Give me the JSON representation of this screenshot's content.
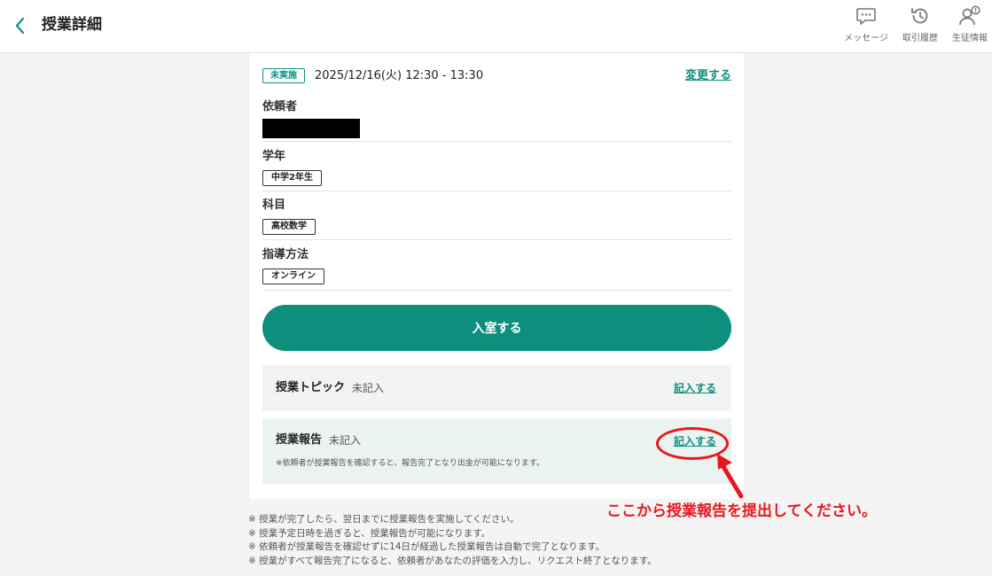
{
  "header": {
    "title": "授業詳細",
    "nav": [
      {
        "label": "メッセージ",
        "icon": "chat-bubble-icon"
      },
      {
        "label": "取引履歴",
        "icon": "history-clock-icon"
      },
      {
        "label": "生徒情報",
        "icon": "student-info-icon"
      }
    ]
  },
  "lesson": {
    "status": "未実施",
    "datetime": "2025/12/16(火) 12:30 - 13:30",
    "change_label": "変更する",
    "requester_label": "依頼者",
    "grade_label": "学年",
    "grade_value": "中学2年生",
    "subject_label": "科目",
    "subject_value": "高校数学",
    "method_label": "指導方法",
    "method_value": "オンライン",
    "enter_button": "入室する"
  },
  "topic": {
    "title": "授業トピック",
    "status": "未記入",
    "link": "記入する"
  },
  "report": {
    "title": "授業報告",
    "status": "未記入",
    "link": "記入する",
    "note": "※依頼者が授業報告を確認すると、報告完了となり出金が可能になります。"
  },
  "annotation": {
    "text": "ここから授業報告を提出してください。",
    "color": "#e8171d"
  },
  "notes": [
    "※ 授業が完了したら、翌日までに授業報告を実施してください。",
    "※ 授業予定日時を過ぎると、授業報告が可能になります。",
    "※ 依頼者が授業報告を確認せずに14日が経過した授業報告は自動で完了となります。",
    "※ 授業がすべて報告完了になると、依頼者があなたの評価を入力し、リクエスト終了となります。"
  ],
  "colors": {
    "accent": "#0e8f7e",
    "annotation": "#e8171d"
  }
}
